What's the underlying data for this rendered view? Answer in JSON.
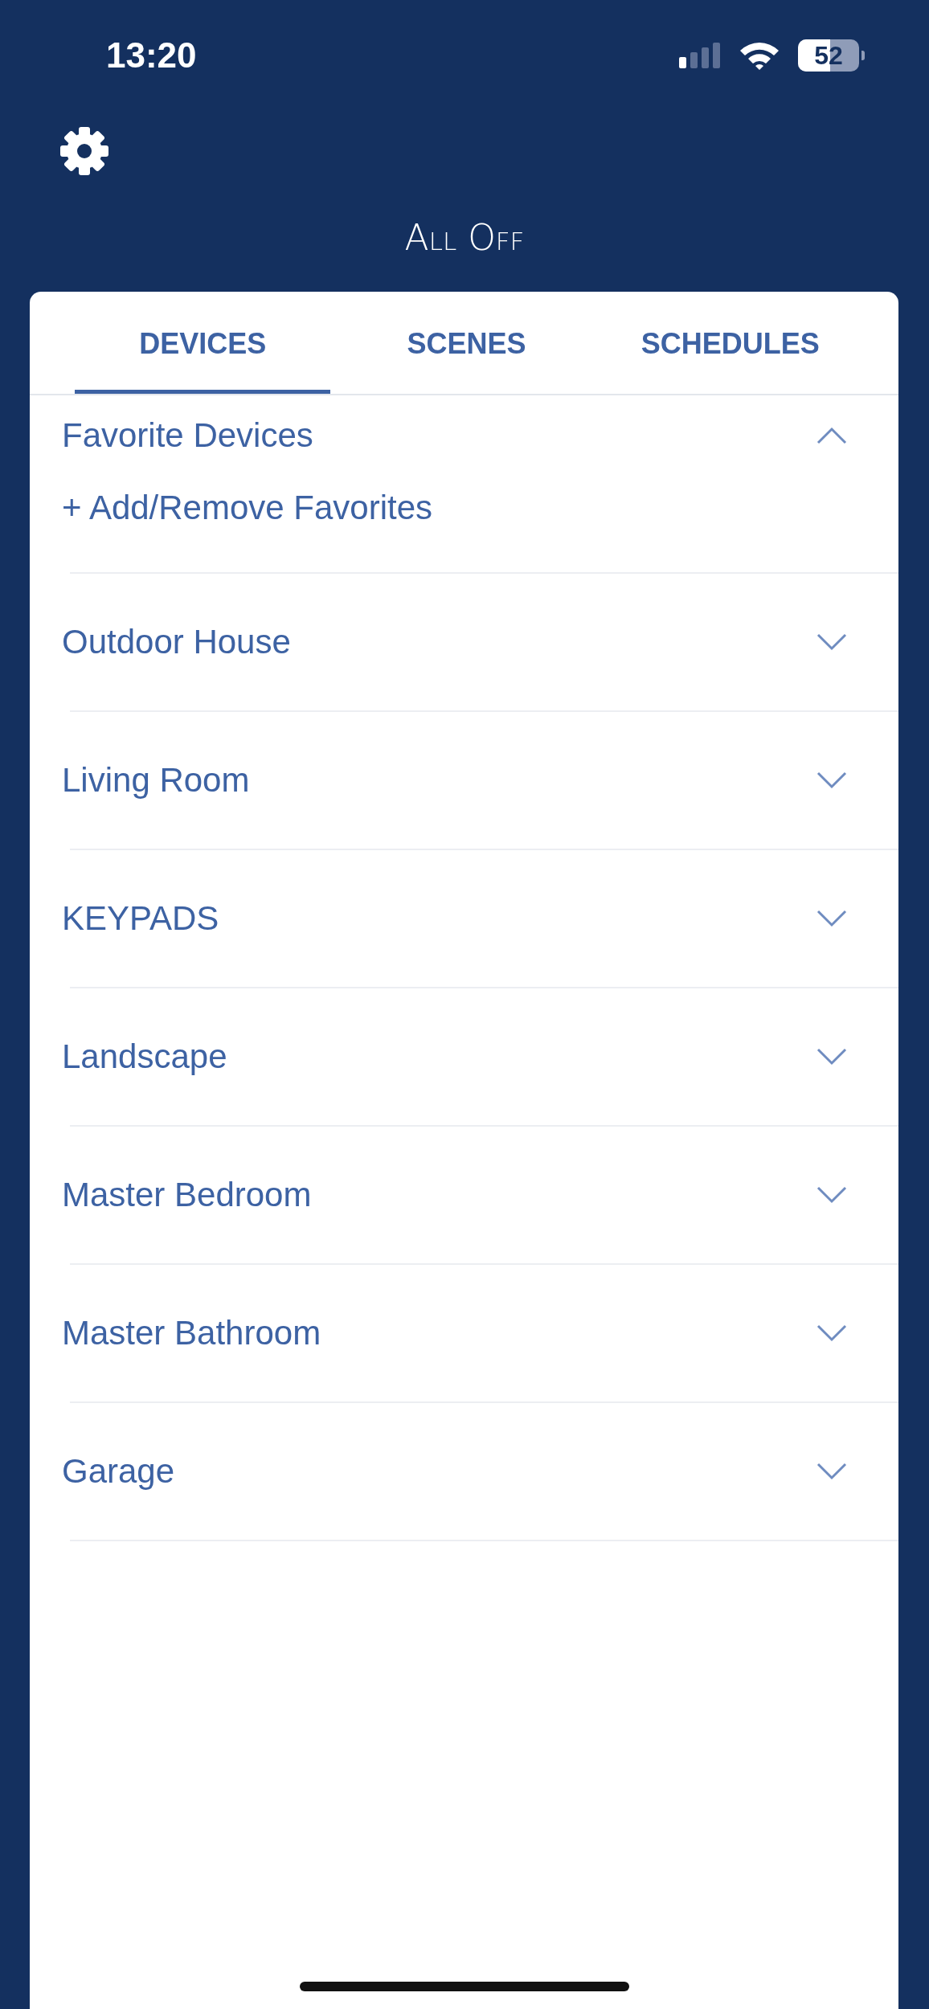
{
  "status_bar": {
    "time": "13:20",
    "battery": "52"
  },
  "title": "All Off",
  "tabs": [
    {
      "label": "DEVICES",
      "selected": true
    },
    {
      "label": "SCENES",
      "selected": false
    },
    {
      "label": "SCHEDULES",
      "selected": false
    }
  ],
  "sections": [
    {
      "name": "Favorite Devices",
      "expanded": true,
      "action": "+ Add/Remove Favorites"
    },
    {
      "name": "Outdoor House",
      "expanded": false
    },
    {
      "name": "Living Room",
      "expanded": false
    },
    {
      "name": "KEYPADS",
      "expanded": false
    },
    {
      "name": "Landscape",
      "expanded": false
    },
    {
      "name": "Master Bedroom",
      "expanded": false
    },
    {
      "name": "Master Bathroom",
      "expanded": false
    },
    {
      "name": "Garage",
      "expanded": false
    }
  ]
}
